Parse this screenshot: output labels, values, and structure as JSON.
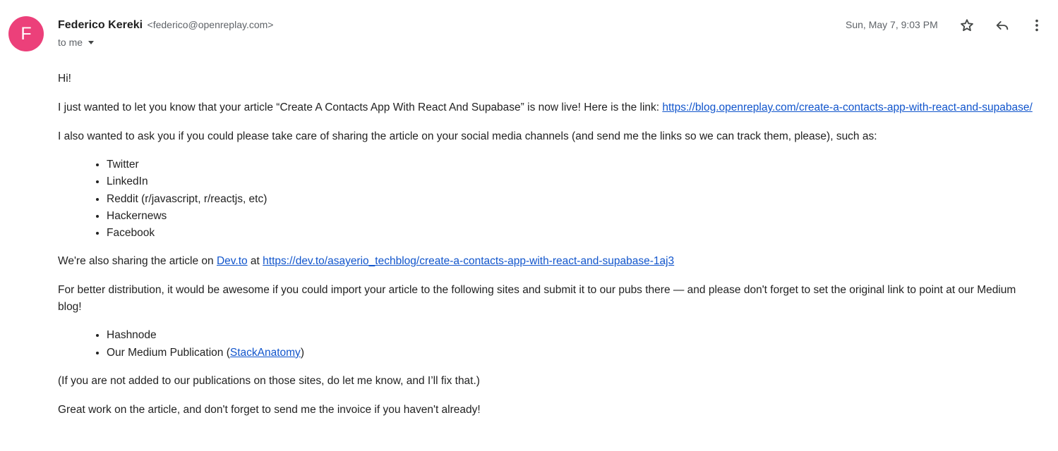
{
  "header": {
    "avatar_letter": "F",
    "avatar_color": "#ec407a",
    "sender_name": "Federico Kereki",
    "sender_email": "<federico@openreplay.com>",
    "to_label": "to me",
    "timestamp": "Sun, May 7, 9:03 PM",
    "icons": [
      "star-icon",
      "reply-icon",
      "more-vert-icon"
    ]
  },
  "body": {
    "greeting": "Hi!",
    "p1_text": "I just wanted to let you know that your article “Create A Contacts App With React And Supabase”  is now live! Here is the link: ",
    "p1_link": "https://blog.openreplay.com/create-a-contacts-app-with-react-and-supabase/",
    "p2": "I also wanted to ask you if you could please take care of sharing the article on your social media channels (and send me the links so we can track them, please), such as:",
    "social_list": [
      "Twitter",
      "LinkedIn",
      "Reddit (r/javascript, r/reactjs, etc)",
      "Hackernews",
      "Facebook"
    ],
    "p3_prefix": "We're also sharing the article on ",
    "p3_link1": "Dev.to",
    "p3_mid": " at ",
    "p3_link2": "https://dev.to/asayerio_techblog/create-a-contacts-app-with-react-and-supabase-1aj3",
    "p4": "For better distribution, it would be awesome if you could import your article to the following sites and submit it to our pubs there — and please don't forget to set the original link to point at our Medium blog!",
    "sites_item1": "Hashnode",
    "sites_item2_prefix": "Our Medium Publication (",
    "sites_item2_link": "StackAnatomy",
    "sites_item2_suffix": ")",
    "p5": "(If you are not added to our publications on those sites, do let me know, and I’ll fix that.)",
    "p6": "Great work on the article, and don't forget to send me the invoice if you haven't already!"
  },
  "colors": {
    "link": "#1155cc",
    "text": "#222222",
    "muted": "#5f6368"
  }
}
